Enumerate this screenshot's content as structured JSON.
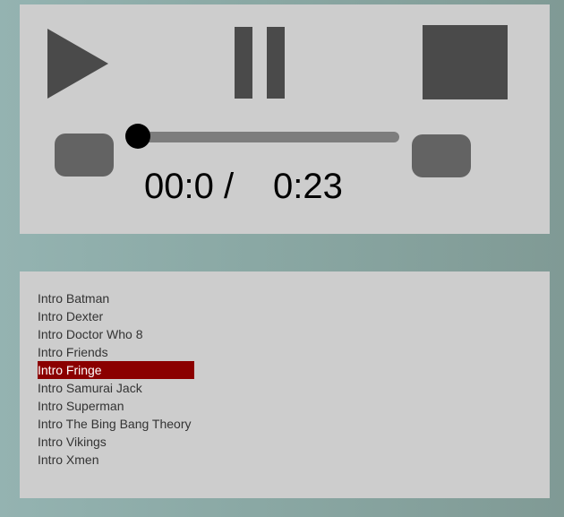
{
  "player": {
    "current_time": "00:0 /",
    "total_time": "0:23",
    "progress": 0.0,
    "icons": {
      "play": "play-icon",
      "pause": "pause-icon",
      "stop": "stop-icon",
      "previous": "previous-button",
      "next": "next-button"
    },
    "colors": {
      "panel": "#cdcdcd",
      "controls": "#4a4a4a",
      "track": "#7d7d7d",
      "thumb": "#000000"
    }
  },
  "playlist": {
    "active_index": 4,
    "active_color": "#8b0000",
    "tracks": [
      {
        "title": "Intro Batman"
      },
      {
        "title": "Intro Dexter"
      },
      {
        "title": "Intro Doctor Who 8"
      },
      {
        "title": "Intro Friends"
      },
      {
        "title": "Intro Fringe"
      },
      {
        "title": "Intro Samurai Jack"
      },
      {
        "title": "Intro Superman"
      },
      {
        "title": "Intro The Bing Bang Theory"
      },
      {
        "title": "Intro Vikings"
      },
      {
        "title": "Intro Xmen"
      }
    ]
  }
}
